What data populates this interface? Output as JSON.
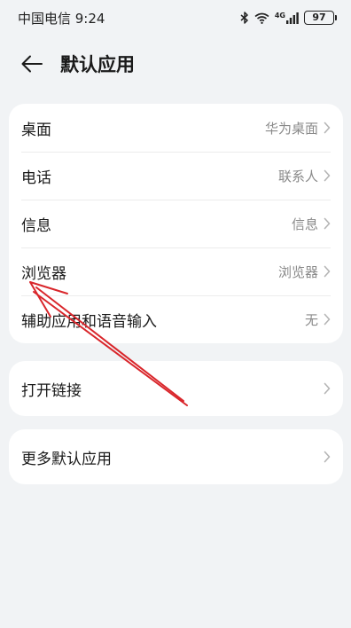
{
  "status_bar": {
    "carrier_time": "中国电信 9:24",
    "network": "4G",
    "battery": "97"
  },
  "header": {
    "title": "默认应用"
  },
  "main_card": {
    "items": [
      {
        "label": "桌面",
        "value": "华为桌面"
      },
      {
        "label": "电话",
        "value": "联系人"
      },
      {
        "label": "信息",
        "value": "信息"
      },
      {
        "label": "浏览器",
        "value": "浏览器"
      },
      {
        "label": "辅助应用和语音输入",
        "value": "无"
      }
    ]
  },
  "links_card": {
    "label": "打开链接"
  },
  "more_card": {
    "label": "更多默认应用"
  },
  "annotation": {
    "arrow_color": "#d9262b"
  }
}
